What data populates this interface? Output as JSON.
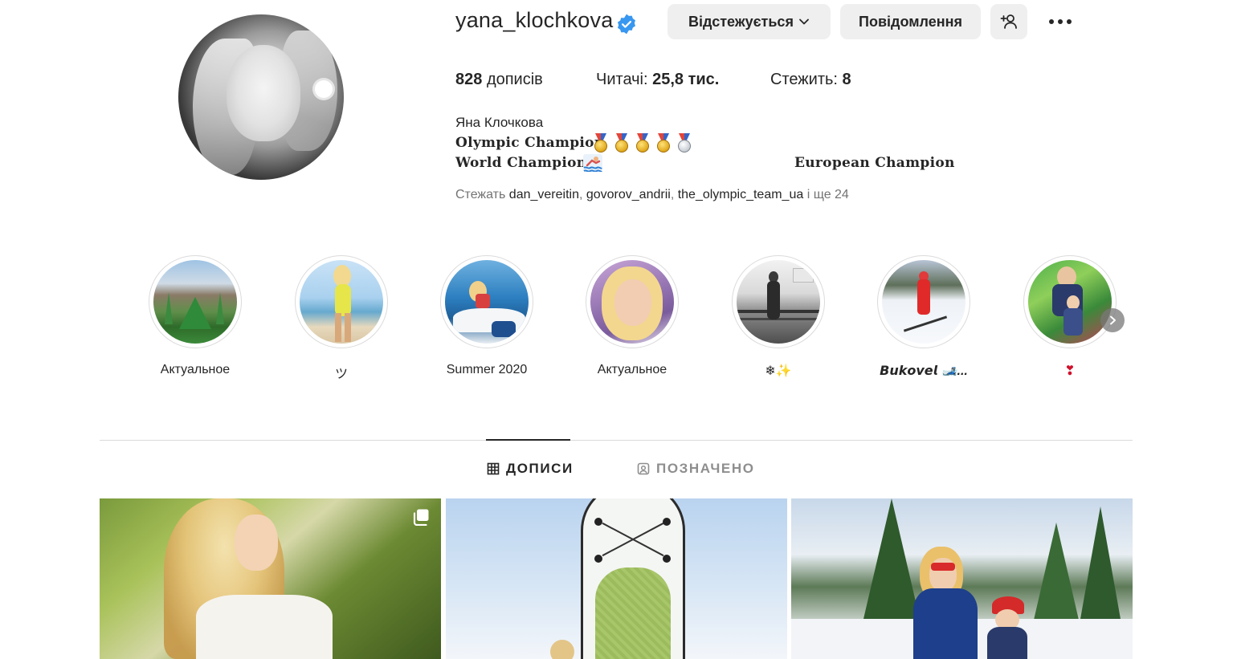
{
  "profile": {
    "username": "yana_klochkova",
    "verified": true,
    "follow_button": "Відстежується",
    "message_button": "Повідомлення",
    "stats": {
      "posts_count": "828",
      "posts_label": "дописів",
      "followers_label": "Читачі:",
      "followers_count": "25,8 тис.",
      "following_label": "Стежить:",
      "following_count": "8"
    },
    "bio": {
      "name": "Яна Клочкова",
      "line1": "Olympic Champion",
      "line2": "World Champion",
      "line2_extra": "European Champion"
    },
    "followed_by": {
      "prefix": "Стежать",
      "accounts": [
        "dan_vereitin",
        "govorov_andrii",
        "the_olympic_team_ua"
      ],
      "suffix": "і ще 24"
    }
  },
  "highlights": [
    {
      "label": "Актуальное"
    },
    {
      "label": "ツ"
    },
    {
      "label": "Summer 2020"
    },
    {
      "label": "Актуальное"
    },
    {
      "label": "❄✨"
    },
    {
      "label": "𝘽𝙪𝙠𝙤𝙫𝙚𝙡 🎿..."
    },
    {
      "label": "❣"
    }
  ],
  "tabs": {
    "posts": "ДОПИСИ",
    "tagged": "ПОЗНАЧЕНО"
  },
  "colors": {
    "verified": "#3897f0",
    "button_bg": "#efefef",
    "text": "#262626",
    "muted": "#737373"
  }
}
